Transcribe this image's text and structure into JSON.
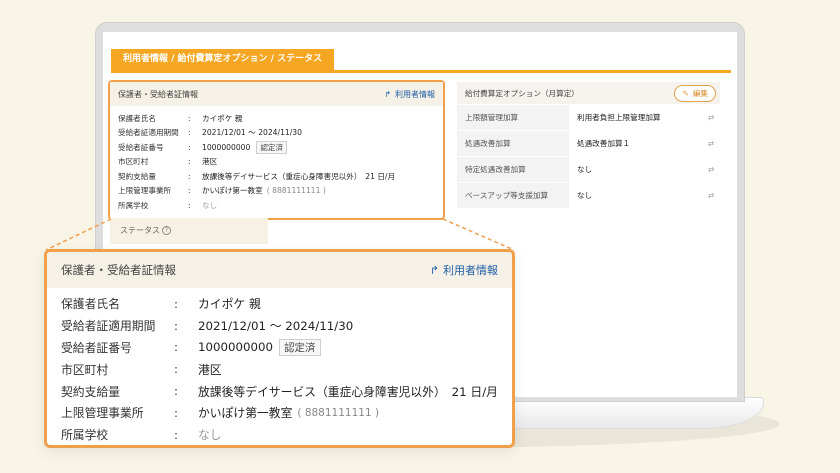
{
  "tab": {
    "label": "利用者情報 / 給付費算定オプション / ステータス"
  },
  "card": {
    "title": "保護者・受給者証情報",
    "link_label": "利用者情報",
    "rows": [
      {
        "label": "保護者氏名",
        "value": "カイポケ 親"
      },
      {
        "label": "受給者証適用期間",
        "value": "2021/12/01 〜 2024/11/30"
      },
      {
        "label": "受給者証番号",
        "value": "1000000000",
        "badge": "認定済"
      },
      {
        "label": "市区町村",
        "value": "港区"
      },
      {
        "label": "契約支給量",
        "value": "放課後等デイサービス（重症心身障害児以外）　21 日/月"
      },
      {
        "label": "上限管理事業所",
        "value": "かいぽけ第一教室",
        "sub": "( 8881111111 )"
      },
      {
        "label": "所属学校",
        "value": "なし"
      }
    ],
    "separator": ":"
  },
  "status": {
    "label": "ステータス",
    "help": "?"
  },
  "options": {
    "title": "給付費算定オプション（月算定）",
    "edit_label": "編集",
    "rows": [
      {
        "key": "上限額管理加算",
        "value": "利用者負担上限管理加算"
      },
      {
        "key": "処遇改善加算",
        "value": "処遇改善加算１"
      },
      {
        "key": "特定処遇改善加算",
        "value": "なし"
      },
      {
        "key": "ベースアップ等支援加算",
        "value": "なし"
      }
    ]
  },
  "colors": {
    "accent": "#f5a623",
    "border": "#f0a04b",
    "link": "#1f5fa8",
    "background": "#f8f4e6"
  },
  "icons": {
    "link": "arrow-share-icon",
    "edit": "pencil-icon",
    "sync": "sync-icon",
    "help": "question-circle-icon"
  }
}
